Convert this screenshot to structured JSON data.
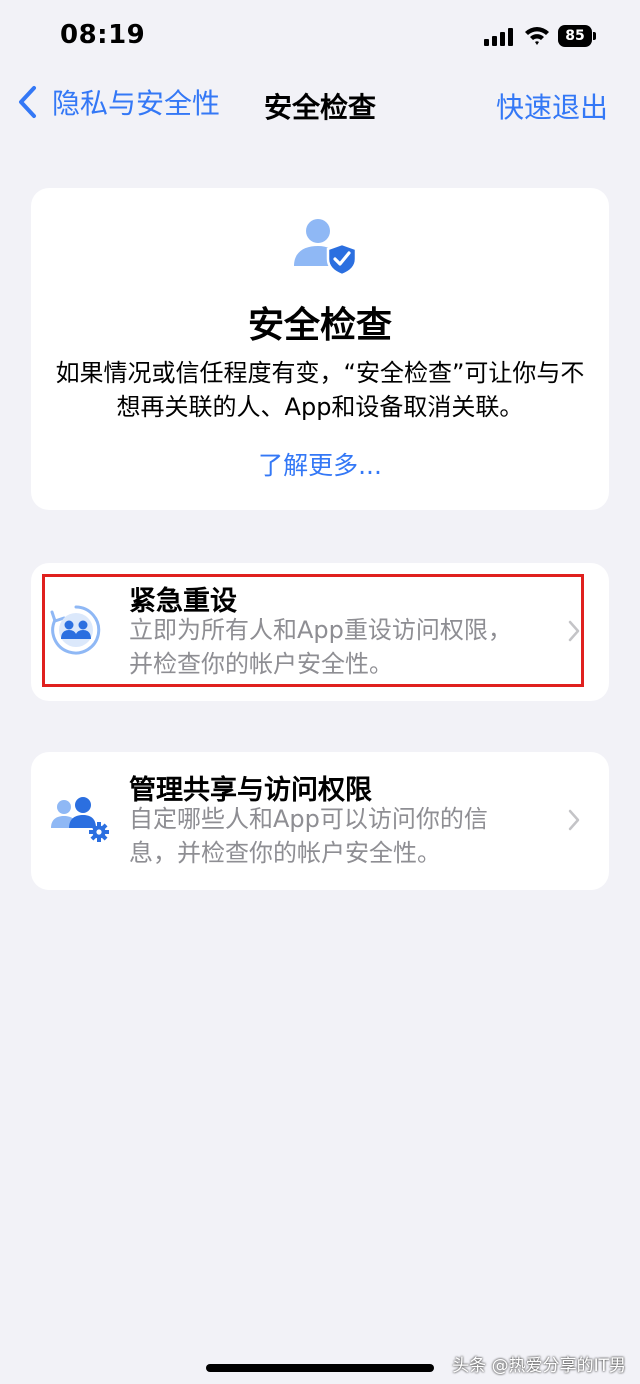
{
  "status_bar": {
    "time": "08:19",
    "battery": "85"
  },
  "nav": {
    "back_label": "隐私与安全性",
    "title": "安全检查",
    "quick_exit_label": "快速退出"
  },
  "hero": {
    "title": "安全检查",
    "description": "如果情况或信任程度有变，“安全检查”可让你与不想再关联的人、App和设备取消关联。",
    "learn_more": "了解更多..."
  },
  "rows": [
    {
      "title": "紧急重设",
      "description": "立即为所有人和App重设访问权限，并检查你的帐户安全性。",
      "icon": "reset-people-icon",
      "highlighted": true
    },
    {
      "title": "管理共享与访问权限",
      "description": "自定哪些人和App可以访问你的信息，并检查你的帐户安全性。",
      "icon": "people-gear-icon"
    }
  ],
  "watermark": "头条 @热爱分享的IT男",
  "colors": {
    "accent": "#3478f6",
    "highlight_border": "#e0201e",
    "background": "#f2f2f7"
  }
}
